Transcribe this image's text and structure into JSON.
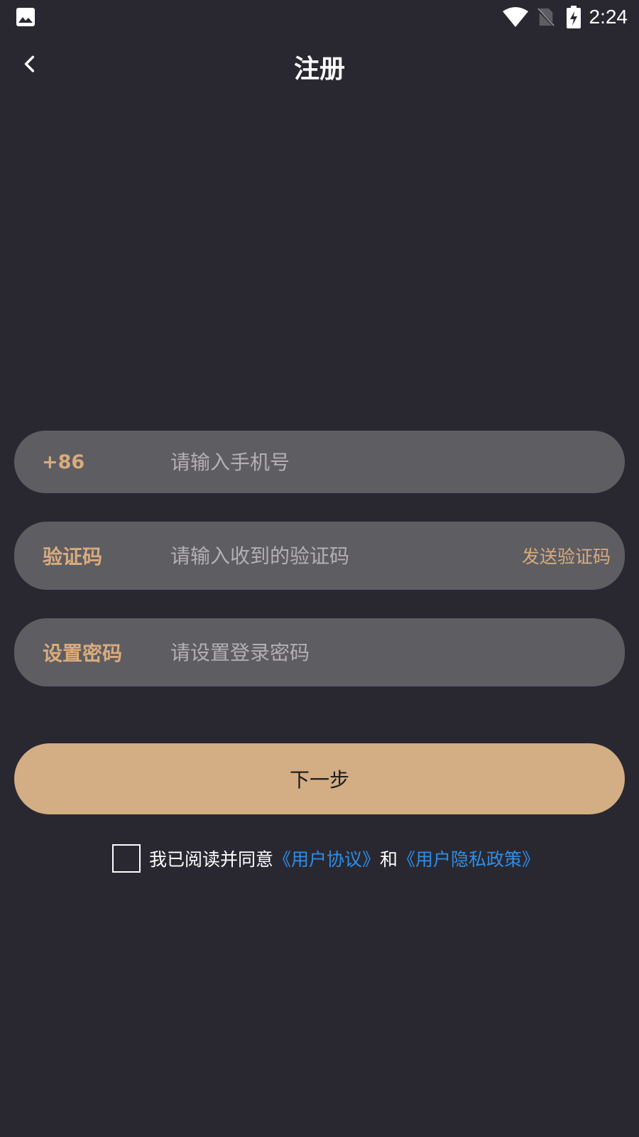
{
  "status_bar": {
    "time": "2:24",
    "icons": [
      "image-icon",
      "wifi-icon",
      "no-sim-icon",
      "battery-charging-icon"
    ]
  },
  "header": {
    "title": "注册",
    "back_icon": "chevron-left-icon"
  },
  "form": {
    "phone": {
      "prefix": "+86",
      "placeholder": "请输入手机号",
      "value": ""
    },
    "code": {
      "label": "验证码",
      "placeholder": "请输入收到的验证码",
      "value": "",
      "send_label": "发送验证码"
    },
    "password": {
      "label": "设置密码",
      "placeholder": "请设置登录密码",
      "value": ""
    },
    "next_label": "下一步"
  },
  "agreement": {
    "checked": false,
    "prefix": "我已阅读并同意",
    "user_agreement": "《用户协议》",
    "conjunction": "和",
    "privacy_policy": "《用户隐私政策》"
  },
  "colors": {
    "background": "#292831",
    "field": "#5e5d62",
    "accent": "#d9ab7d",
    "button": "#d3ad83",
    "link": "#2f8ee8"
  }
}
